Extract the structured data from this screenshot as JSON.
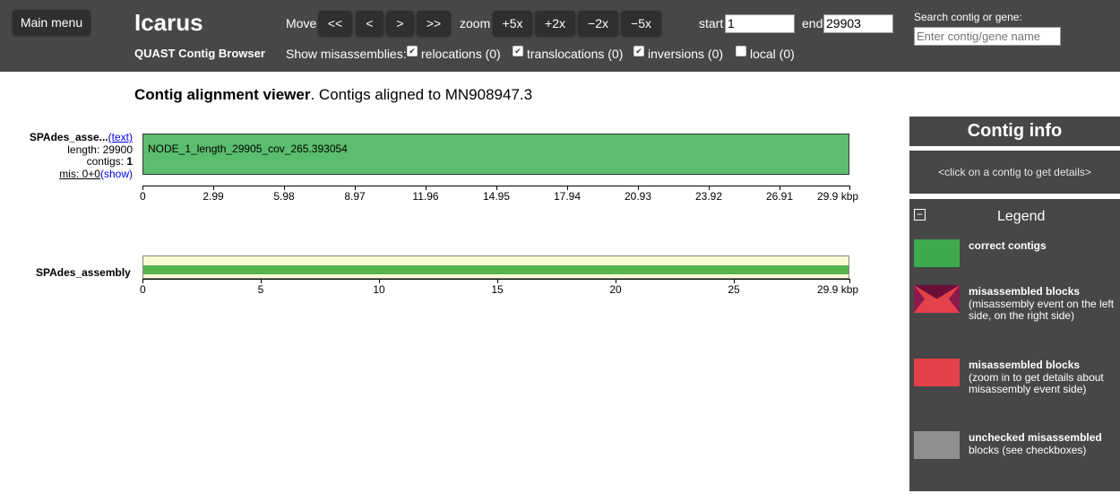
{
  "header": {
    "main_menu_label": "Main menu",
    "app_title": "Icarus",
    "app_subtitle": "QUAST Contig Browser",
    "move_label": "Move",
    "move_buttons": [
      "<<",
      "<",
      ">",
      ">>"
    ],
    "zoom_label": "zoom",
    "zoom_buttons": [
      "+5x",
      "+2x",
      "−2x",
      "−5x"
    ],
    "start_label": "start",
    "start_value": "1",
    "end_label": "end",
    "end_value": "29903",
    "search_label": "Search contig or gene:",
    "search_placeholder": "Enter contig/gene name",
    "misassemblies_label": "Show misassemblies:",
    "misassembly_filters": [
      {
        "label": "relocations (0)",
        "checked": true
      },
      {
        "label": "translocations (0)",
        "checked": true
      },
      {
        "label": "inversions (0)",
        "checked": true
      },
      {
        "label": "local (0)",
        "checked": false
      }
    ]
  },
  "main": {
    "title_bold": "Contig alignment viewer",
    "title_rest": ". Contigs aligned to MN908947.3",
    "assembly": {
      "name": "SPAdes_asse...",
      "text_link": "(text)",
      "length_label": "length: 29900",
      "contigs_label": "contigs:",
      "contigs_value": "1",
      "mis_label": "mis: 0+0",
      "show_link": "(show)"
    },
    "contig_name": "NODE_1_length_29905_cov_265.393054",
    "top_ticks": [
      "0",
      "2.99",
      "5.98",
      "8.97",
      "11.96",
      "14.95",
      "17.94",
      "20.93",
      "23.92",
      "26.91",
      "29.9 kbp"
    ],
    "overview_name": "SPAdes_assembly",
    "bottom_ticks": [
      "0",
      "5",
      "10",
      "15",
      "20",
      "25",
      "29.9 kbp"
    ]
  },
  "sidebar": {
    "contig_info_title": "Contig info",
    "contig_info_hint": "<click on a contig to get details>",
    "legend_title": "Legend",
    "legend_toggle": "−",
    "legend_items": [
      {
        "title": "correct contigs",
        "desc": "",
        "color": "#3eaa4e",
        "icon": "correct-swatch"
      },
      {
        "title": "misassembled blocks",
        "desc": "(misassembly event on the left side, on the right side)",
        "color": "#e3424a",
        "icon": "misassembled-both-sides-swatch"
      },
      {
        "title": "misassembled blocks",
        "desc": "(zoom in to get details about misassembly event side)",
        "color": "#e3424a",
        "icon": "misassembled-swatch"
      },
      {
        "title": "unchecked misassembled",
        "desc": "blocks (see checkboxes)",
        "color": "#8f8f8f",
        "icon": "unchecked-swatch"
      }
    ]
  },
  "colors": {
    "topbar": "#474747",
    "contig_green": "#5bbe6e",
    "overview_green": "#56b44f",
    "overview_bg": "#fafad2",
    "link_blue": "#0000ee"
  }
}
